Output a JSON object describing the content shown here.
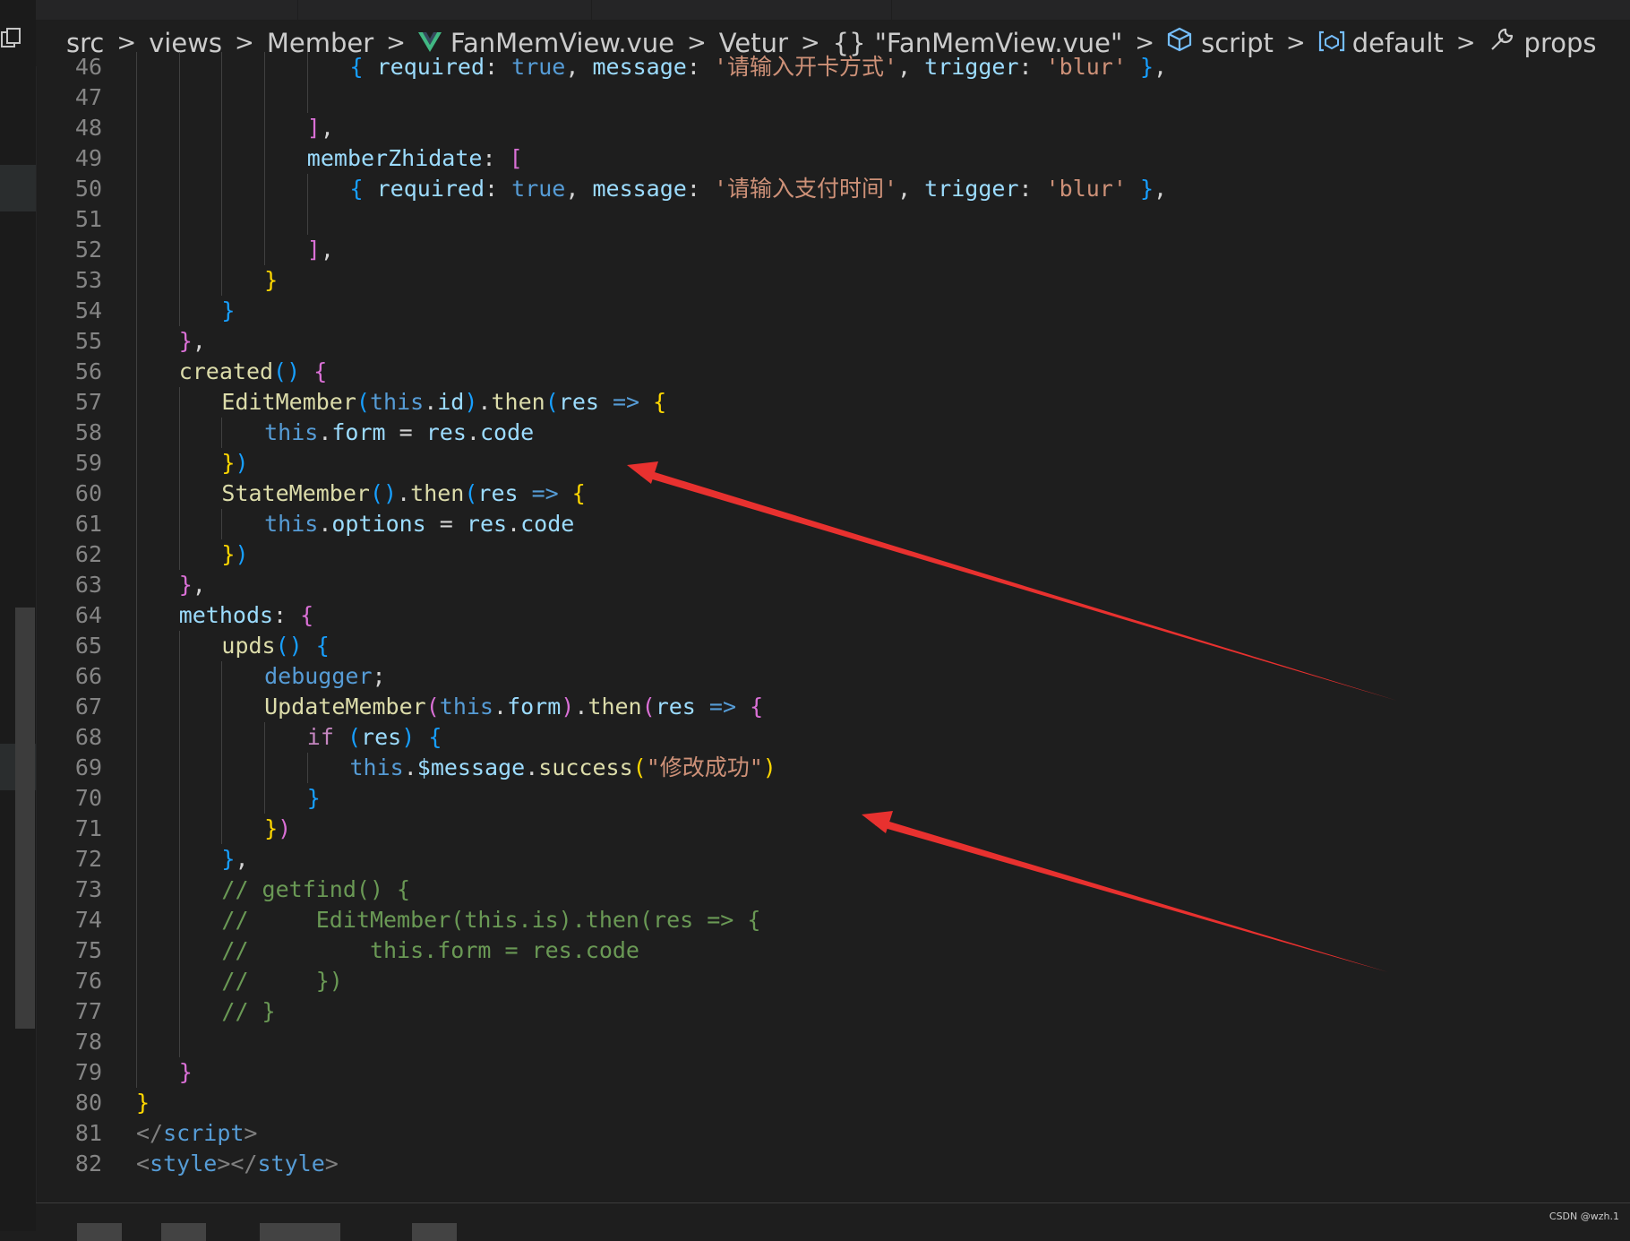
{
  "breadcrumb": {
    "items": [
      "src",
      "views",
      "Member",
      "FanMemView.vue",
      "Vetur",
      "\"FanMemView.vue\"",
      "script",
      "default",
      "props"
    ],
    "separator": ">"
  },
  "editor": {
    "lines": [
      {
        "num": "46",
        "indent": 5,
        "code": [
          {
            "t": "{ ",
            "c": "p3"
          },
          {
            "t": "required",
            "c": "prop"
          },
          {
            "t": ": ",
            "c": ""
          },
          {
            "t": "true",
            "c": "k"
          },
          {
            "t": ", ",
            "c": ""
          },
          {
            "t": "message",
            "c": "prop"
          },
          {
            "t": ": ",
            "c": ""
          },
          {
            "t": "'请输入开卡方式'",
            "c": "str"
          },
          {
            "t": ", ",
            "c": ""
          },
          {
            "t": "trigger",
            "c": "prop"
          },
          {
            "t": ": ",
            "c": ""
          },
          {
            "t": "'blur'",
            "c": "str"
          },
          {
            "t": " }",
            "c": "p3"
          },
          {
            "t": ",",
            "c": ""
          }
        ]
      },
      {
        "num": "47",
        "indent": 5,
        "code": []
      },
      {
        "num": "48",
        "indent": 4,
        "code": [
          {
            "t": "]",
            "c": "p2"
          },
          {
            "t": ",",
            "c": ""
          }
        ]
      },
      {
        "num": "49",
        "indent": 4,
        "code": [
          {
            "t": "memberZhidate",
            "c": "prop"
          },
          {
            "t": ": ",
            "c": ""
          },
          {
            "t": "[",
            "c": "p2"
          }
        ]
      },
      {
        "num": "50",
        "indent": 5,
        "code": [
          {
            "t": "{ ",
            "c": "p3"
          },
          {
            "t": "required",
            "c": "prop"
          },
          {
            "t": ": ",
            "c": ""
          },
          {
            "t": "true",
            "c": "k"
          },
          {
            "t": ", ",
            "c": ""
          },
          {
            "t": "message",
            "c": "prop"
          },
          {
            "t": ": ",
            "c": ""
          },
          {
            "t": "'请输入支付时间'",
            "c": "str"
          },
          {
            "t": ", ",
            "c": ""
          },
          {
            "t": "trigger",
            "c": "prop"
          },
          {
            "t": ": ",
            "c": ""
          },
          {
            "t": "'blur'",
            "c": "str"
          },
          {
            "t": " }",
            "c": "p3"
          },
          {
            "t": ",",
            "c": ""
          }
        ]
      },
      {
        "num": "51",
        "indent": 5,
        "code": []
      },
      {
        "num": "52",
        "indent": 4,
        "code": [
          {
            "t": "]",
            "c": "p2"
          },
          {
            "t": ",",
            "c": ""
          }
        ]
      },
      {
        "num": "53",
        "indent": 3,
        "code": [
          {
            "t": "}",
            "c": "p1"
          }
        ]
      },
      {
        "num": "54",
        "indent": 2,
        "code": [
          {
            "t": "}",
            "c": "p3"
          }
        ]
      },
      {
        "num": "55",
        "indent": 1,
        "code": [
          {
            "t": "}",
            "c": "p2"
          },
          {
            "t": ",",
            "c": ""
          }
        ]
      },
      {
        "num": "56",
        "indent": 1,
        "code": [
          {
            "t": "created",
            "c": "fn"
          },
          {
            "t": "()",
            "c": "p3"
          },
          {
            "t": " ",
            "c": ""
          },
          {
            "t": "{",
            "c": "p2"
          }
        ]
      },
      {
        "num": "57",
        "indent": 2,
        "code": [
          {
            "t": "EditMember",
            "c": "fn"
          },
          {
            "t": "(",
            "c": "p3"
          },
          {
            "t": "this",
            "c": "k"
          },
          {
            "t": ".",
            "c": ""
          },
          {
            "t": "id",
            "c": "prop"
          },
          {
            "t": ")",
            "c": "p3"
          },
          {
            "t": ".",
            "c": ""
          },
          {
            "t": "then",
            "c": "fn"
          },
          {
            "t": "(",
            "c": "p3"
          },
          {
            "t": "res",
            "c": "prop"
          },
          {
            "t": " => ",
            "c": "k"
          },
          {
            "t": "{",
            "c": "p1"
          }
        ]
      },
      {
        "num": "58",
        "indent": 3,
        "code": [
          {
            "t": "this",
            "c": "k"
          },
          {
            "t": ".",
            "c": ""
          },
          {
            "t": "form",
            "c": "prop"
          },
          {
            "t": " = ",
            "c": ""
          },
          {
            "t": "res",
            "c": "prop"
          },
          {
            "t": ".",
            "c": ""
          },
          {
            "t": "code",
            "c": "prop"
          }
        ]
      },
      {
        "num": "59",
        "indent": 2,
        "code": [
          {
            "t": "}",
            "c": "p1"
          },
          {
            "t": ")",
            "c": "p3"
          }
        ]
      },
      {
        "num": "60",
        "indent": 2,
        "code": [
          {
            "t": "StateMember",
            "c": "fn"
          },
          {
            "t": "()",
            "c": "p3"
          },
          {
            "t": ".",
            "c": ""
          },
          {
            "t": "then",
            "c": "fn"
          },
          {
            "t": "(",
            "c": "p3"
          },
          {
            "t": "res",
            "c": "prop"
          },
          {
            "t": " => ",
            "c": "k"
          },
          {
            "t": "{",
            "c": "p1"
          }
        ]
      },
      {
        "num": "61",
        "indent": 3,
        "code": [
          {
            "t": "this",
            "c": "k"
          },
          {
            "t": ".",
            "c": ""
          },
          {
            "t": "options",
            "c": "prop"
          },
          {
            "t": " = ",
            "c": ""
          },
          {
            "t": "res",
            "c": "prop"
          },
          {
            "t": ".",
            "c": ""
          },
          {
            "t": "code",
            "c": "prop"
          }
        ]
      },
      {
        "num": "62",
        "indent": 2,
        "code": [
          {
            "t": "}",
            "c": "p1"
          },
          {
            "t": ")",
            "c": "p3"
          }
        ]
      },
      {
        "num": "63",
        "indent": 1,
        "code": [
          {
            "t": "}",
            "c": "p2"
          },
          {
            "t": ",",
            "c": ""
          }
        ]
      },
      {
        "num": "64",
        "indent": 1,
        "code": [
          {
            "t": "methods",
            "c": "prop"
          },
          {
            "t": ": ",
            "c": ""
          },
          {
            "t": "{",
            "c": "p2"
          }
        ]
      },
      {
        "num": "65",
        "indent": 2,
        "code": [
          {
            "t": "upds",
            "c": "fn"
          },
          {
            "t": "()",
            "c": "p3"
          },
          {
            "t": " ",
            "c": ""
          },
          {
            "t": "{",
            "c": "p3"
          }
        ]
      },
      {
        "num": "66",
        "indent": 3,
        "code": [
          {
            "t": "debugger",
            "c": "k"
          },
          {
            "t": ";",
            "c": ""
          }
        ]
      },
      {
        "num": "67",
        "indent": 3,
        "code": [
          {
            "t": "UpdateMember",
            "c": "fn"
          },
          {
            "t": "(",
            "c": "p2"
          },
          {
            "t": "this",
            "c": "k"
          },
          {
            "t": ".",
            "c": ""
          },
          {
            "t": "form",
            "c": "prop"
          },
          {
            "t": ")",
            "c": "p2"
          },
          {
            "t": ".",
            "c": ""
          },
          {
            "t": "then",
            "c": "fn"
          },
          {
            "t": "(",
            "c": "p2"
          },
          {
            "t": "res",
            "c": "prop"
          },
          {
            "t": " => ",
            "c": "k"
          },
          {
            "t": "{",
            "c": "p2"
          }
        ]
      },
      {
        "num": "68",
        "indent": 4,
        "code": [
          {
            "t": "if",
            "c": "ctl"
          },
          {
            "t": " ",
            "c": ""
          },
          {
            "t": "(",
            "c": "p3"
          },
          {
            "t": "res",
            "c": "prop"
          },
          {
            "t": ")",
            "c": "p3"
          },
          {
            "t": " ",
            "c": ""
          },
          {
            "t": "{",
            "c": "p3"
          }
        ]
      },
      {
        "num": "69",
        "indent": 5,
        "code": [
          {
            "t": "this",
            "c": "k"
          },
          {
            "t": ".",
            "c": ""
          },
          {
            "t": "$message",
            "c": "prop"
          },
          {
            "t": ".",
            "c": ""
          },
          {
            "t": "success",
            "c": "fn"
          },
          {
            "t": "(",
            "c": "p1"
          },
          {
            "t": "\"修改成功\"",
            "c": "str"
          },
          {
            "t": ")",
            "c": "p1"
          }
        ]
      },
      {
        "num": "70",
        "indent": 4,
        "code": [
          {
            "t": "}",
            "c": "p3"
          }
        ]
      },
      {
        "num": "71",
        "indent": 3,
        "code": [
          {
            "t": "}",
            "c": "p1"
          },
          {
            "t": ")",
            "c": "p2"
          }
        ]
      },
      {
        "num": "72",
        "indent": 2,
        "code": [
          {
            "t": "}",
            "c": "p3"
          },
          {
            "t": ",",
            "c": ""
          }
        ]
      },
      {
        "num": "73",
        "indent": 2,
        "code": [
          {
            "t": "// getfind() {",
            "c": "cm"
          }
        ]
      },
      {
        "num": "74",
        "indent": 2,
        "code": [
          {
            "t": "//     EditMember(this.is).then(res => {",
            "c": "cm"
          }
        ]
      },
      {
        "num": "75",
        "indent": 2,
        "code": [
          {
            "t": "//         this.form = res.code",
            "c": "cm"
          }
        ]
      },
      {
        "num": "76",
        "indent": 2,
        "code": [
          {
            "t": "//     })",
            "c": "cm"
          }
        ]
      },
      {
        "num": "77",
        "indent": 2,
        "code": [
          {
            "t": "// }",
            "c": "cm"
          }
        ]
      },
      {
        "num": "78",
        "indent": 2,
        "code": []
      },
      {
        "num": "79",
        "indent": 1,
        "code": [
          {
            "t": "}",
            "c": "p2"
          }
        ]
      },
      {
        "num": "80",
        "indent": 0,
        "code": [
          {
            "t": "}",
            "c": "p1"
          }
        ]
      },
      {
        "num": "81",
        "indent": 0,
        "code": [
          {
            "t": "</",
            "c": "ang"
          },
          {
            "t": "script",
            "c": "tag"
          },
          {
            "t": ">",
            "c": "ang"
          }
        ]
      },
      {
        "num": "82",
        "indent": 0,
        "code": [
          {
            "t": "<",
            "c": "ang"
          },
          {
            "t": "style",
            "c": "tag"
          },
          {
            "t": "></",
            "c": "ang"
          },
          {
            "t": "style",
            "c": "tag"
          },
          {
            "t": ">",
            "c": "ang"
          }
        ]
      }
    ]
  },
  "watermark": "CSDN @wzh.1",
  "annotations": {
    "arrow_color": "#e8312f",
    "count": 2
  }
}
